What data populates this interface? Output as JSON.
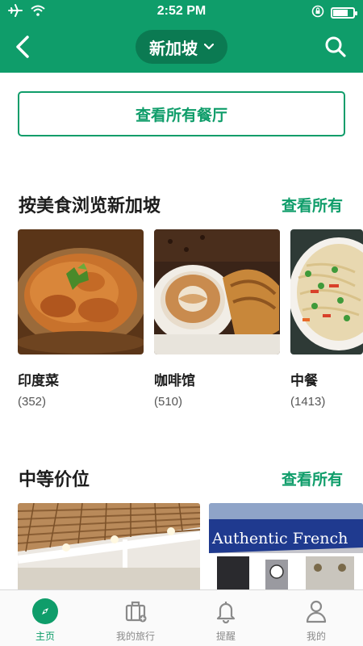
{
  "status_bar": {
    "time": "2:52 PM"
  },
  "header": {
    "city": "新加坡"
  },
  "view_all_restaurants_label": "查看所有餐厅",
  "cuisine_section": {
    "title": "按美食浏览新加坡",
    "link": "查看所有",
    "items": [
      {
        "name": "印度菜",
        "count": "(352)"
      },
      {
        "name": "咖啡馆",
        "count": "(510)"
      },
      {
        "name": "中餐",
        "count": "(1413)"
      }
    ]
  },
  "price_section": {
    "title": "中等价位",
    "link": "查看所有",
    "items": [
      {
        "sign_text": ""
      },
      {
        "sign_text": "Authentic French"
      }
    ]
  },
  "tab_bar": {
    "tabs": [
      {
        "label": "主页",
        "icon": "compass-icon",
        "active": true
      },
      {
        "label": "我的旅行",
        "icon": "suitcase-icon",
        "active": false
      },
      {
        "label": "提醒",
        "icon": "bell-icon",
        "active": false
      },
      {
        "label": "我的",
        "icon": "person-icon",
        "active": false
      }
    ]
  },
  "colors": {
    "brand": "#0f9d6a",
    "brand_dark": "#0b7a52",
    "tab_inactive": "#8a8a8a"
  }
}
